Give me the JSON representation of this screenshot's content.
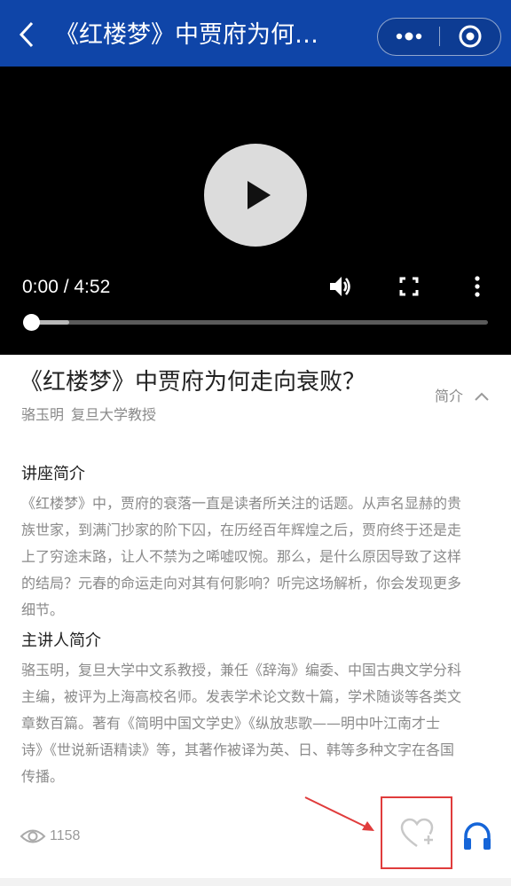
{
  "header": {
    "title": "《红楼梦》中贾府为何…",
    "background_color": "#0f45a8",
    "back_icon": "chevron-left-icon",
    "more_icon": "more-dots-icon",
    "close_icon": "target-close-icon"
  },
  "video": {
    "current_time": "0:00",
    "duration": "4:52",
    "time_display": "0:00 / 4:52",
    "progress": 0,
    "buffered": 0.1,
    "icons": [
      "play-icon",
      "volume-icon",
      "fullscreen-icon",
      "more-vertical-icon"
    ]
  },
  "lecture": {
    "title": "《红楼梦》中贾府为何走向衰败？",
    "intro_toggle": "简介",
    "speaker_name": "骆玉明",
    "speaker_title": "复旦大学教授"
  },
  "sections": {
    "lecture_intro": {
      "heading": "讲座简介",
      "lines": [
        "《红楼梦》中，贾府的衰落一直是读者所关注的话题。从声名显赫的贵",
        "族世家，到满门抄家的阶下囚，在历经百年辉煌之后，贾府终于还是走",
        "上了穷途末路，让人不禁为之唏嘘叹惋。那么，是什么原因导致了这样",
        "的结局？元春的命运走向对其有何影响？听完这场解析，你会发现更多",
        "细节。"
      ]
    },
    "speaker_intro": {
      "heading": "主讲人简介",
      "lines": [
        "骆玉明，复旦大学中文系教授，兼任《辞海》编委、中国古典文学分科",
        "主编，被评为上海高校名师。发表学术论文数十篇，学术随谈等各类文",
        "章数百篇。著有《简明中国文学史》《纵放悲歌——明中叶江南才士",
        "诗》《世说新语精读》等，其著作被译为英、日、韩等多种文字在各国",
        "传播。"
      ]
    }
  },
  "footer": {
    "views_icon": "eye-icon",
    "view_count": "1158",
    "favorite_icon": "heart-plus-icon",
    "audio_icon": "headphones-icon",
    "audio_color": "#1565d8",
    "annotation_color": "#e03c3c"
  }
}
